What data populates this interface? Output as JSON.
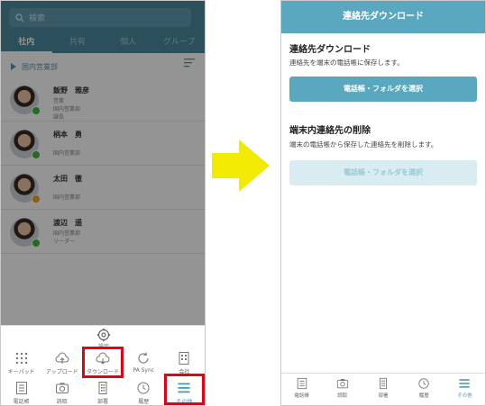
{
  "left": {
    "search_placeholder": "検索",
    "tabs": [
      "社内",
      "共有",
      "個人",
      "グループ"
    ],
    "group_label": "国内営業部",
    "contacts": [
      {
        "name": "飯野　雅彦",
        "lines": [
          "営業",
          "国内営業部",
          "課長"
        ],
        "status": "online"
      },
      {
        "name": "柄本　勇",
        "lines": [
          "",
          "国内営業部"
        ],
        "status": "online"
      },
      {
        "name": "太田　徹",
        "lines": [
          "",
          "国内営業部"
        ],
        "status": "away"
      },
      {
        "name": "渡辺　遥",
        "lines": [
          "国内営業部",
          "リーダー"
        ],
        "status": "online"
      }
    ],
    "settings_label": "設定",
    "menu_row1": [
      {
        "label": "キーパッド",
        "icon": "keypad-icon"
      },
      {
        "label": "アップロード",
        "icon": "upload-cloud-icon"
      },
      {
        "label": "ダウンロード",
        "icon": "download-cloud-icon"
      },
      {
        "label": "PA Sync",
        "icon": "sync-icon"
      },
      {
        "label": "会社",
        "icon": "company-icon"
      }
    ],
    "menu_row2": [
      {
        "label": "電話帳",
        "icon": "phonebook-icon"
      },
      {
        "label": "読取",
        "icon": "camera-icon"
      },
      {
        "label": "部署",
        "icon": "department-icon"
      },
      {
        "label": "履歴",
        "icon": "history-icon"
      },
      {
        "label": "その他",
        "icon": "menu-icon"
      }
    ]
  },
  "right": {
    "title": "連絡先ダウンロード",
    "section1": {
      "title": "連絡先ダウンロード",
      "desc": "連絡先を端末の電話帳に保存します。",
      "button": "電話帳・フォルダを選択"
    },
    "section2": {
      "title": "端末内連絡先の削除",
      "desc": "端末の電話帳から保存した連絡先を削除します。",
      "button": "電話帳・フォルダを選択"
    },
    "tab_bar": [
      {
        "label": "電話帳",
        "icon": "phonebook-icon"
      },
      {
        "label": "読取",
        "icon": "camera-icon"
      },
      {
        "label": "部署",
        "icon": "department-icon"
      },
      {
        "label": "履歴",
        "icon": "history-icon"
      },
      {
        "label": "その他",
        "icon": "menu-icon"
      }
    ]
  },
  "colors": {
    "accent": "#5aa8bf",
    "highlight_border": "#e60012",
    "arrow": "#f0eb00"
  }
}
